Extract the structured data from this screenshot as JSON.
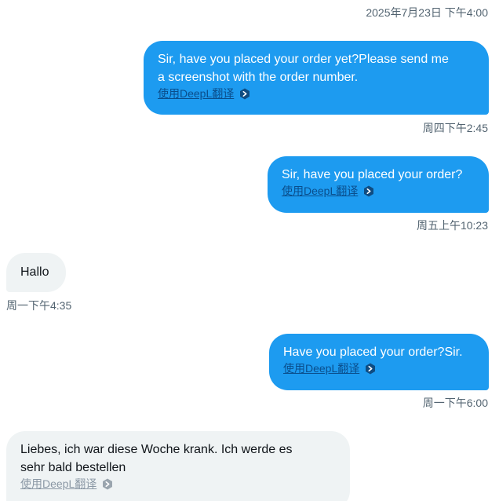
{
  "messages": [
    {
      "side": "sent",
      "timestamp": "2025年7月23日 下午4:00",
      "text": "Sir, have you placed your order yet?Please send me\na screenshot with the order number.",
      "translate_label": "使用DeepL翻译"
    },
    {
      "side": "sent",
      "timestamp": "周四下午2:45",
      "text": "Sir, have you placed your order?",
      "translate_label": "使用DeepL翻译"
    },
    {
      "side": "received",
      "timestamp": "周五上午10:23",
      "text": "Hallo"
    },
    {
      "side": "sent",
      "timestamp": "周一下午4:35",
      "text": "Have you placed your order?Sir.",
      "translate_label": "使用DeepL翻译"
    },
    {
      "side": "received",
      "timestamp": "周一下午6:00",
      "text": "Liebes, ich war diese Woche krank. Ich werde es\nsehr bald bestellen",
      "translate_label": "使用DeepL翻译"
    }
  ],
  "icons": {
    "translate": "deepl-icon"
  },
  "colors": {
    "sent_bubble": "#1d9bf0",
    "received_bubble": "#eff3f4",
    "timestamp": "#536471",
    "sent_link": "#0a4e8c",
    "received_link": "#8b98a5"
  }
}
